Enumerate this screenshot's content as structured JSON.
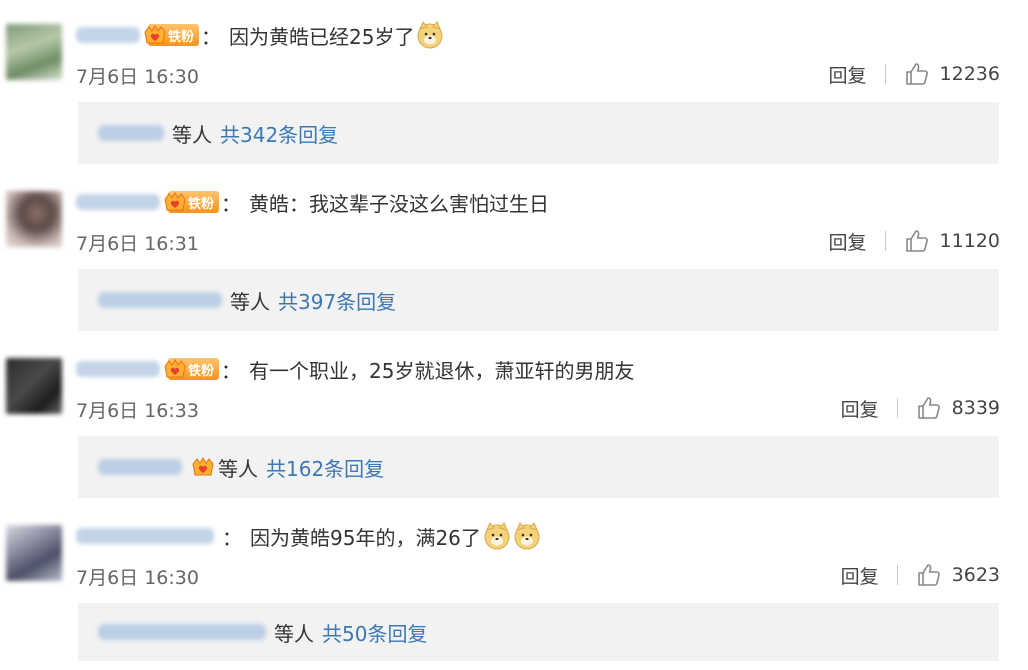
{
  "fan_badge_label": "铁粉",
  "reply_action_label": "回复",
  "comments": [
    {
      "text": "因为黄皓已经25岁了",
      "date": "7月6日 16:30",
      "likes": "12236",
      "reply_prefix": "等人",
      "reply_total": "共342条回复"
    },
    {
      "text": "黄皓：我这辈子没这么害怕过生日",
      "date": "7月6日 16:31",
      "likes": "11120",
      "reply_prefix": "等人",
      "reply_total": "共397条回复"
    },
    {
      "text": "有一个职业，25岁就退休，萧亚轩的男朋友",
      "date": "7月6日 16:33",
      "likes": "8339",
      "reply_prefix": "等人",
      "reply_total": "共162条回复"
    },
    {
      "text": "因为黄皓95年的，满26了",
      "date": "7月6日 16:30",
      "likes": "3623",
      "reply_prefix": "等人",
      "reply_total": "共50条回复"
    }
  ],
  "icons": {
    "fan_badge": "crown-heart-icon",
    "emoji": "doge-emoji-icon",
    "like": "thumbs-up-icon"
  },
  "colors": {
    "link": "#3c78b4",
    "reply_background": "#f2f2f2",
    "badge_orange": "#f7931e"
  }
}
